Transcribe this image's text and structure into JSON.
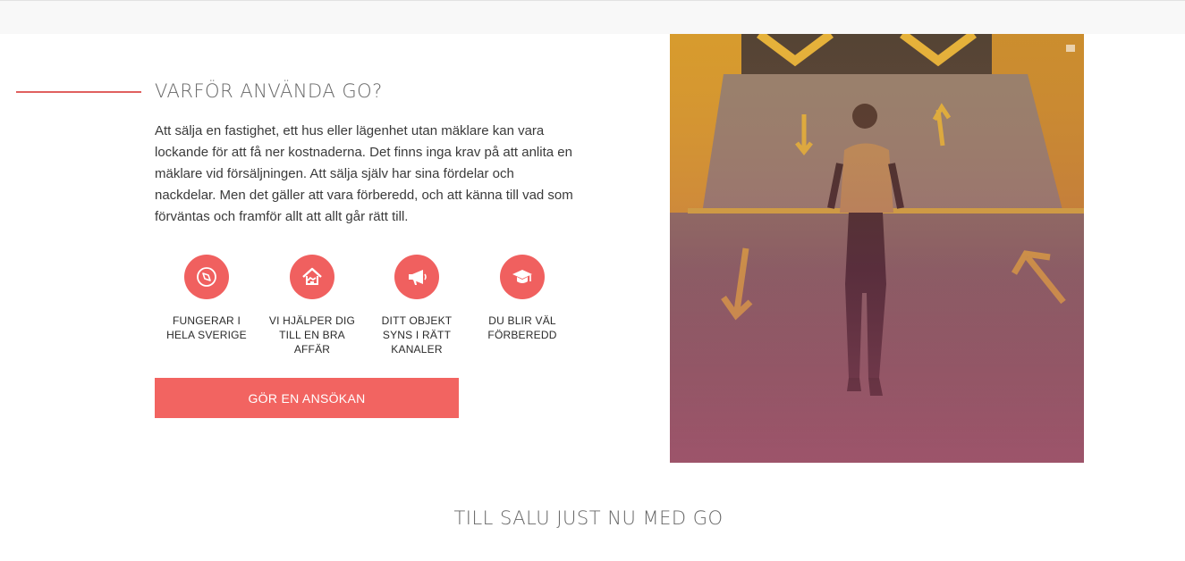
{
  "section": {
    "heading": "VARFÖR ANVÄNDA GO?",
    "body": "Att sälja en fastighet, ett hus eller lägenhet utan mäklare kan vara lockande för att få ner kostnaderna. Det finns inga krav på att anlita en mäklare vid försäljningen. Att sälja själv har sina fördelar och nackdelar. Men det gäller att vara förberedd, och att känna till vad som förväntas och framför allt att allt går rätt till.",
    "features": [
      {
        "icon": "compass-icon",
        "label": "FUNGERAR I HELA SVERIGE"
      },
      {
        "icon": "house-handshake-icon",
        "label": "VI HJÄLPER DIG TILL EN BRA AFFÄR"
      },
      {
        "icon": "megaphone-icon",
        "label": "DITT OBJEKT SYNS I RÄTT KANALER"
      },
      {
        "icon": "graduation-cap-icon",
        "label": "DU BLIR VÄL FÖRBEREDD"
      }
    ],
    "cta_label": "GÖR EN ANSÖKAN"
  },
  "listing": {
    "heading": "TILL SALU JUST NU MED GO"
  },
  "colors": {
    "accent": "#f26461",
    "photo_overlay": "#c8506a"
  }
}
